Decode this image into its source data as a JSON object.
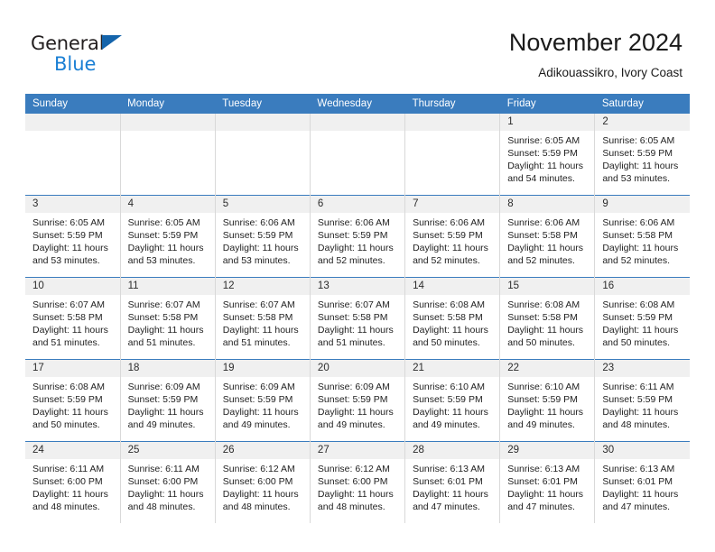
{
  "brand": {
    "word1": "General",
    "word2": "Blue",
    "triangle_color": "#1464ab",
    "word2_color": "#1a7fd4"
  },
  "header": {
    "title": "November 2024",
    "subtitle": "Adikouassikro, Ivory Coast",
    "header_bg": "#3a7cbe",
    "daynum_bg": "#f0f0f0"
  },
  "weekdays": [
    "Sunday",
    "Monday",
    "Tuesday",
    "Wednesday",
    "Thursday",
    "Friday",
    "Saturday"
  ],
  "weeks": [
    [
      {
        "day": "",
        "sunrise": "",
        "sunset": "",
        "daylight1": "",
        "daylight2": "",
        "empty": true
      },
      {
        "day": "",
        "sunrise": "",
        "sunset": "",
        "daylight1": "",
        "daylight2": "",
        "empty": true
      },
      {
        "day": "",
        "sunrise": "",
        "sunset": "",
        "daylight1": "",
        "daylight2": "",
        "empty": true
      },
      {
        "day": "",
        "sunrise": "",
        "sunset": "",
        "daylight1": "",
        "daylight2": "",
        "empty": true
      },
      {
        "day": "",
        "sunrise": "",
        "sunset": "",
        "daylight1": "",
        "daylight2": "",
        "empty": true
      },
      {
        "day": "1",
        "sunrise": "Sunrise: 6:05 AM",
        "sunset": "Sunset: 5:59 PM",
        "daylight1": "Daylight: 11 hours",
        "daylight2": "and 54 minutes."
      },
      {
        "day": "2",
        "sunrise": "Sunrise: 6:05 AM",
        "sunset": "Sunset: 5:59 PM",
        "daylight1": "Daylight: 11 hours",
        "daylight2": "and 53 minutes."
      }
    ],
    [
      {
        "day": "3",
        "sunrise": "Sunrise: 6:05 AM",
        "sunset": "Sunset: 5:59 PM",
        "daylight1": "Daylight: 11 hours",
        "daylight2": "and 53 minutes."
      },
      {
        "day": "4",
        "sunrise": "Sunrise: 6:05 AM",
        "sunset": "Sunset: 5:59 PM",
        "daylight1": "Daylight: 11 hours",
        "daylight2": "and 53 minutes."
      },
      {
        "day": "5",
        "sunrise": "Sunrise: 6:06 AM",
        "sunset": "Sunset: 5:59 PM",
        "daylight1": "Daylight: 11 hours",
        "daylight2": "and 53 minutes."
      },
      {
        "day": "6",
        "sunrise": "Sunrise: 6:06 AM",
        "sunset": "Sunset: 5:59 PM",
        "daylight1": "Daylight: 11 hours",
        "daylight2": "and 52 minutes."
      },
      {
        "day": "7",
        "sunrise": "Sunrise: 6:06 AM",
        "sunset": "Sunset: 5:59 PM",
        "daylight1": "Daylight: 11 hours",
        "daylight2": "and 52 minutes."
      },
      {
        "day": "8",
        "sunrise": "Sunrise: 6:06 AM",
        "sunset": "Sunset: 5:58 PM",
        "daylight1": "Daylight: 11 hours",
        "daylight2": "and 52 minutes."
      },
      {
        "day": "9",
        "sunrise": "Sunrise: 6:06 AM",
        "sunset": "Sunset: 5:58 PM",
        "daylight1": "Daylight: 11 hours",
        "daylight2": "and 52 minutes."
      }
    ],
    [
      {
        "day": "10",
        "sunrise": "Sunrise: 6:07 AM",
        "sunset": "Sunset: 5:58 PM",
        "daylight1": "Daylight: 11 hours",
        "daylight2": "and 51 minutes."
      },
      {
        "day": "11",
        "sunrise": "Sunrise: 6:07 AM",
        "sunset": "Sunset: 5:58 PM",
        "daylight1": "Daylight: 11 hours",
        "daylight2": "and 51 minutes."
      },
      {
        "day": "12",
        "sunrise": "Sunrise: 6:07 AM",
        "sunset": "Sunset: 5:58 PM",
        "daylight1": "Daylight: 11 hours",
        "daylight2": "and 51 minutes."
      },
      {
        "day": "13",
        "sunrise": "Sunrise: 6:07 AM",
        "sunset": "Sunset: 5:58 PM",
        "daylight1": "Daylight: 11 hours",
        "daylight2": "and 51 minutes."
      },
      {
        "day": "14",
        "sunrise": "Sunrise: 6:08 AM",
        "sunset": "Sunset: 5:58 PM",
        "daylight1": "Daylight: 11 hours",
        "daylight2": "and 50 minutes."
      },
      {
        "day": "15",
        "sunrise": "Sunrise: 6:08 AM",
        "sunset": "Sunset: 5:58 PM",
        "daylight1": "Daylight: 11 hours",
        "daylight2": "and 50 minutes."
      },
      {
        "day": "16",
        "sunrise": "Sunrise: 6:08 AM",
        "sunset": "Sunset: 5:59 PM",
        "daylight1": "Daylight: 11 hours",
        "daylight2": "and 50 minutes."
      }
    ],
    [
      {
        "day": "17",
        "sunrise": "Sunrise: 6:08 AM",
        "sunset": "Sunset: 5:59 PM",
        "daylight1": "Daylight: 11 hours",
        "daylight2": "and 50 minutes."
      },
      {
        "day": "18",
        "sunrise": "Sunrise: 6:09 AM",
        "sunset": "Sunset: 5:59 PM",
        "daylight1": "Daylight: 11 hours",
        "daylight2": "and 49 minutes."
      },
      {
        "day": "19",
        "sunrise": "Sunrise: 6:09 AM",
        "sunset": "Sunset: 5:59 PM",
        "daylight1": "Daylight: 11 hours",
        "daylight2": "and 49 minutes."
      },
      {
        "day": "20",
        "sunrise": "Sunrise: 6:09 AM",
        "sunset": "Sunset: 5:59 PM",
        "daylight1": "Daylight: 11 hours",
        "daylight2": "and 49 minutes."
      },
      {
        "day": "21",
        "sunrise": "Sunrise: 6:10 AM",
        "sunset": "Sunset: 5:59 PM",
        "daylight1": "Daylight: 11 hours",
        "daylight2": "and 49 minutes."
      },
      {
        "day": "22",
        "sunrise": "Sunrise: 6:10 AM",
        "sunset": "Sunset: 5:59 PM",
        "daylight1": "Daylight: 11 hours",
        "daylight2": "and 49 minutes."
      },
      {
        "day": "23",
        "sunrise": "Sunrise: 6:11 AM",
        "sunset": "Sunset: 5:59 PM",
        "daylight1": "Daylight: 11 hours",
        "daylight2": "and 48 minutes."
      }
    ],
    [
      {
        "day": "24",
        "sunrise": "Sunrise: 6:11 AM",
        "sunset": "Sunset: 6:00 PM",
        "daylight1": "Daylight: 11 hours",
        "daylight2": "and 48 minutes."
      },
      {
        "day": "25",
        "sunrise": "Sunrise: 6:11 AM",
        "sunset": "Sunset: 6:00 PM",
        "daylight1": "Daylight: 11 hours",
        "daylight2": "and 48 minutes."
      },
      {
        "day": "26",
        "sunrise": "Sunrise: 6:12 AM",
        "sunset": "Sunset: 6:00 PM",
        "daylight1": "Daylight: 11 hours",
        "daylight2": "and 48 minutes."
      },
      {
        "day": "27",
        "sunrise": "Sunrise: 6:12 AM",
        "sunset": "Sunset: 6:00 PM",
        "daylight1": "Daylight: 11 hours",
        "daylight2": "and 48 minutes."
      },
      {
        "day": "28",
        "sunrise": "Sunrise: 6:13 AM",
        "sunset": "Sunset: 6:01 PM",
        "daylight1": "Daylight: 11 hours",
        "daylight2": "and 47 minutes."
      },
      {
        "day": "29",
        "sunrise": "Sunrise: 6:13 AM",
        "sunset": "Sunset: 6:01 PM",
        "daylight1": "Daylight: 11 hours",
        "daylight2": "and 47 minutes."
      },
      {
        "day": "30",
        "sunrise": "Sunrise: 6:13 AM",
        "sunset": "Sunset: 6:01 PM",
        "daylight1": "Daylight: 11 hours",
        "daylight2": "and 47 minutes."
      }
    ]
  ]
}
